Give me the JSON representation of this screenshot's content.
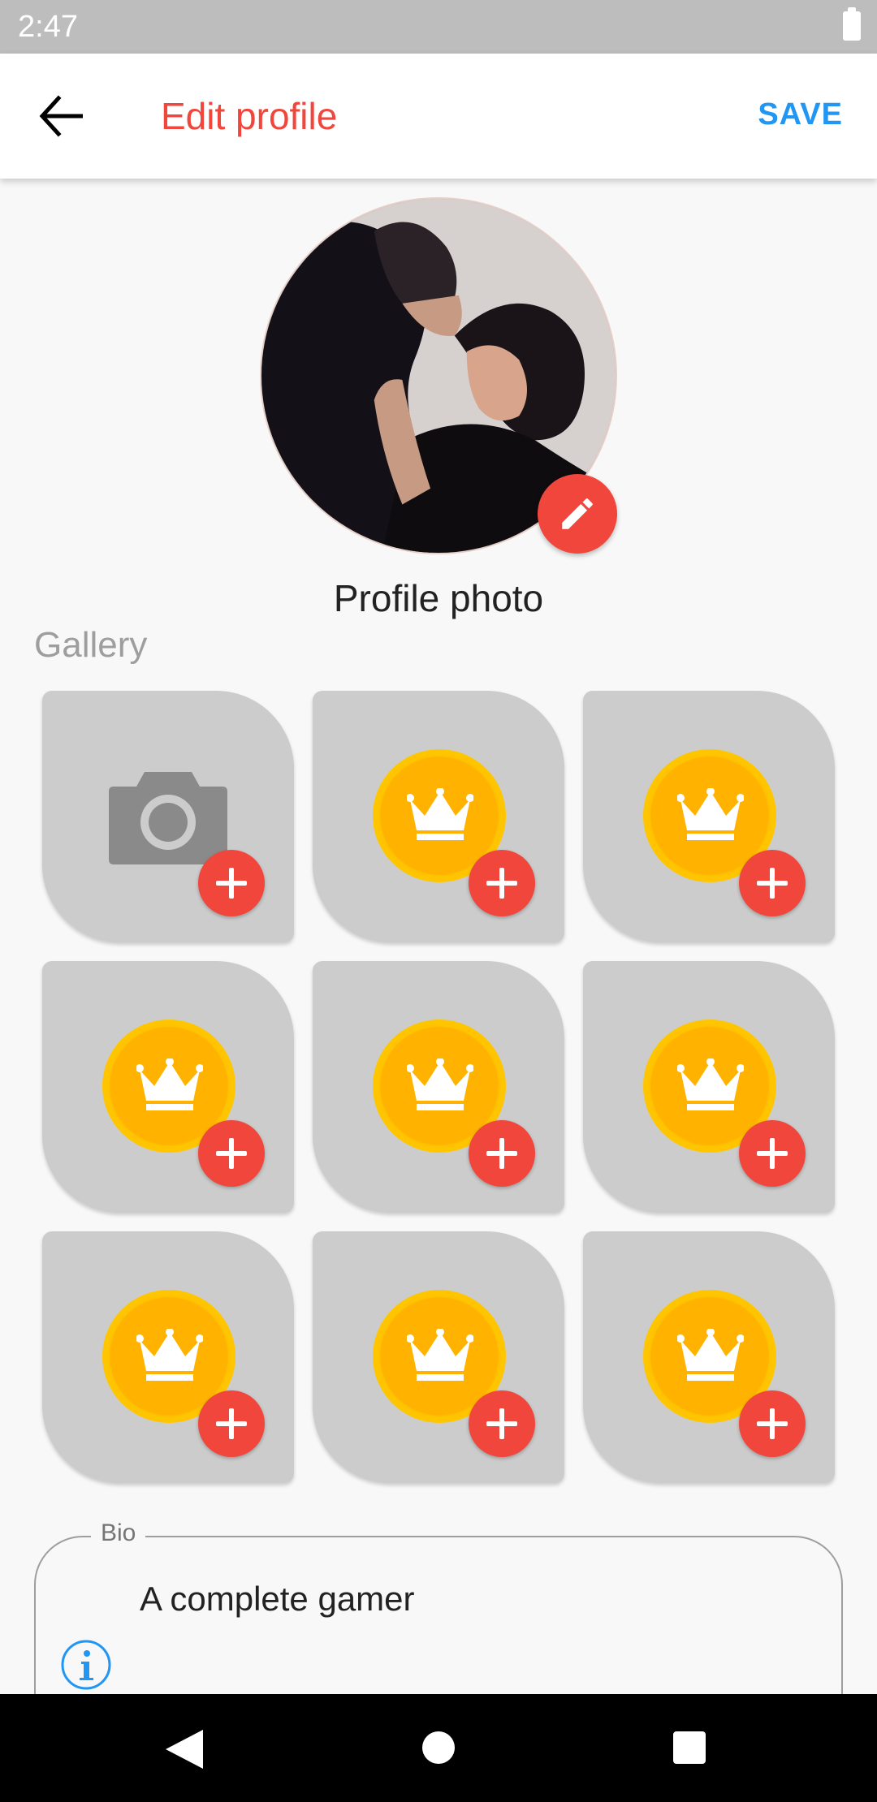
{
  "status_bar": {
    "time": "2:47",
    "battery_icon": "battery-full-icon"
  },
  "app_bar": {
    "back_icon": "arrow-left-icon",
    "title": "Edit profile",
    "save_label": "SAVE",
    "title_color": "#f0463c",
    "save_color": "#2196f3"
  },
  "profile": {
    "photo_label": "Profile photo",
    "edit_icon": "pencil-icon",
    "accent": "#f0463c"
  },
  "gallery": {
    "label": "Gallery",
    "tiles": [
      {
        "icon": "camera-icon"
      },
      {
        "icon": "crown-coin-icon"
      },
      {
        "icon": "crown-coin-icon"
      },
      {
        "icon": "crown-coin-icon"
      },
      {
        "icon": "crown-coin-icon"
      },
      {
        "icon": "crown-coin-icon"
      },
      {
        "icon": "crown-coin-icon"
      },
      {
        "icon": "crown-coin-icon"
      },
      {
        "icon": "crown-coin-icon"
      }
    ],
    "add_icon": "plus-icon"
  },
  "bio": {
    "legend": "Bio",
    "text": "A complete gamer",
    "info_icon": "info-icon"
  },
  "nav_bar": {
    "back_icon": "triangle-back-icon",
    "home_icon": "circle-home-icon",
    "recents_icon": "square-recents-icon"
  }
}
